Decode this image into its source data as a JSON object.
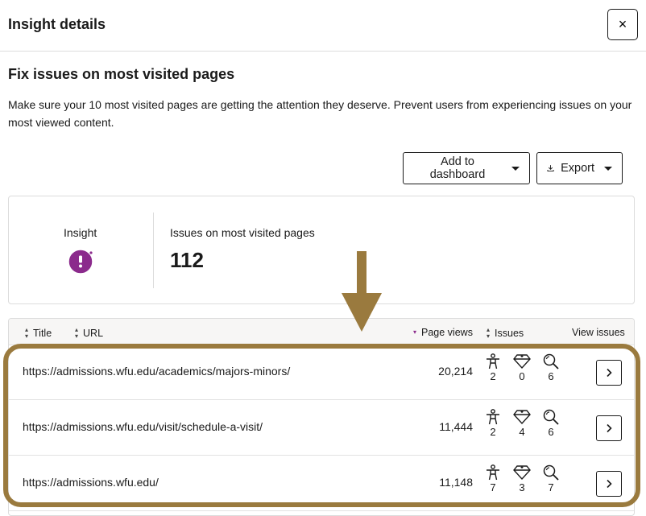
{
  "header": {
    "title": "Insight details",
    "close_label": "×"
  },
  "section": {
    "title": "Fix issues on most visited pages",
    "description": "Make sure your 10 most visited pages are getting the attention they deserve. Prevent users from experiencing issues on your most viewed content."
  },
  "toolbar": {
    "add_dashboard_label": "Add to dashboard",
    "export_label": "Export"
  },
  "insight": {
    "label": "Insight",
    "icon": "alert-circle-icon",
    "metric_label": "Issues on most visited pages",
    "metric_value": "112",
    "accent_color": "#8b2a8c"
  },
  "table": {
    "columns": {
      "title": "Title",
      "url": "URL",
      "page_views": "Page views",
      "issues": "Issues",
      "view_issues": "View issues"
    },
    "rows": [
      {
        "url": "https://admissions.wfu.edu/academics/majors-minors/",
        "page_views": "20,214",
        "accessibility": "2",
        "quality": "0",
        "seo": "6"
      },
      {
        "url": "https://admissions.wfu.edu/visit/schedule-a-visit/",
        "page_views": "11,444",
        "accessibility": "2",
        "quality": "4",
        "seo": "6"
      },
      {
        "url": "https://admissions.wfu.edu/",
        "page_views": "11,148",
        "accessibility": "7",
        "quality": "3",
        "seo": "7"
      }
    ]
  },
  "annotation": {
    "color": "#9a7a3e"
  }
}
